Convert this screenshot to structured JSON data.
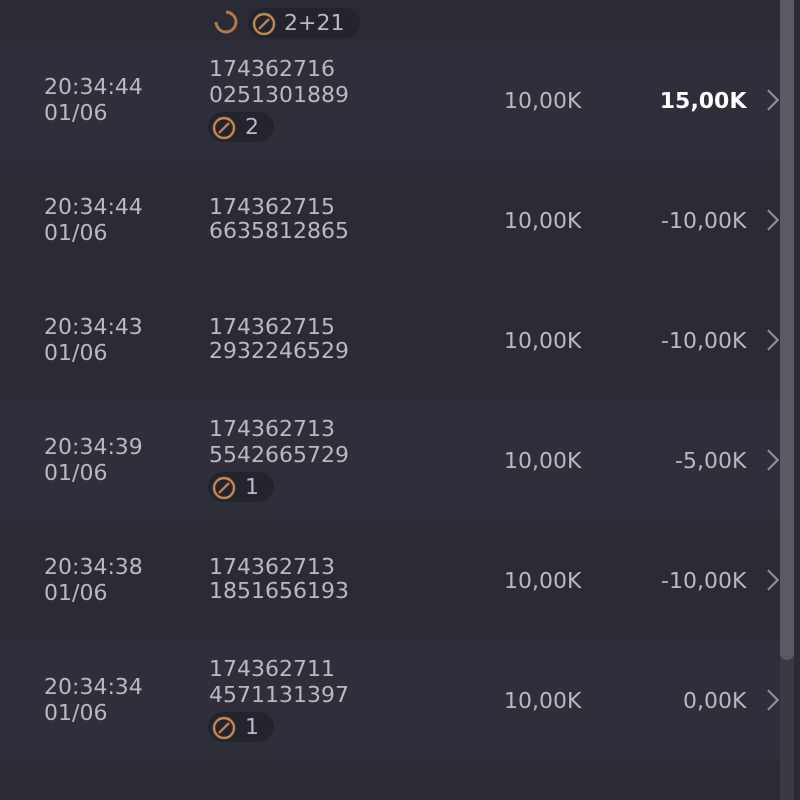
{
  "top_row": {
    "pending": true,
    "badge": "2+21"
  },
  "rows": [
    {
      "time": "20:34:44",
      "date": "01/06",
      "id_1": "174362716",
      "id_2": "0251301889",
      "badge": "2",
      "amount": "10,00K",
      "result": "15,00K",
      "positive": true
    },
    {
      "time": "20:34:44",
      "date": "01/06",
      "id_1": "174362715",
      "id_2": "6635812865",
      "amount": "10,00K",
      "result": "-10,00K",
      "positive": false
    },
    {
      "time": "20:34:43",
      "date": "01/06",
      "id_1": "174362715",
      "id_2": "2932246529",
      "amount": "10,00K",
      "result": "-10,00K",
      "positive": false
    },
    {
      "time": "20:34:39",
      "date": "01/06",
      "id_1": "174362713",
      "id_2": "5542665729",
      "badge": "1",
      "amount": "10,00K",
      "result": "-5,00K",
      "positive": false
    },
    {
      "time": "20:34:38",
      "date": "01/06",
      "id_1": "174362713",
      "id_2": "1851656193",
      "amount": "10,00K",
      "result": "-10,00K",
      "positive": false
    },
    {
      "time": "20:34:34",
      "date": "01/06",
      "id_1": "174362711",
      "id_2": "4571131397",
      "badge": "1",
      "amount": "10,00K",
      "result": "0,00K",
      "positive": false
    }
  ]
}
